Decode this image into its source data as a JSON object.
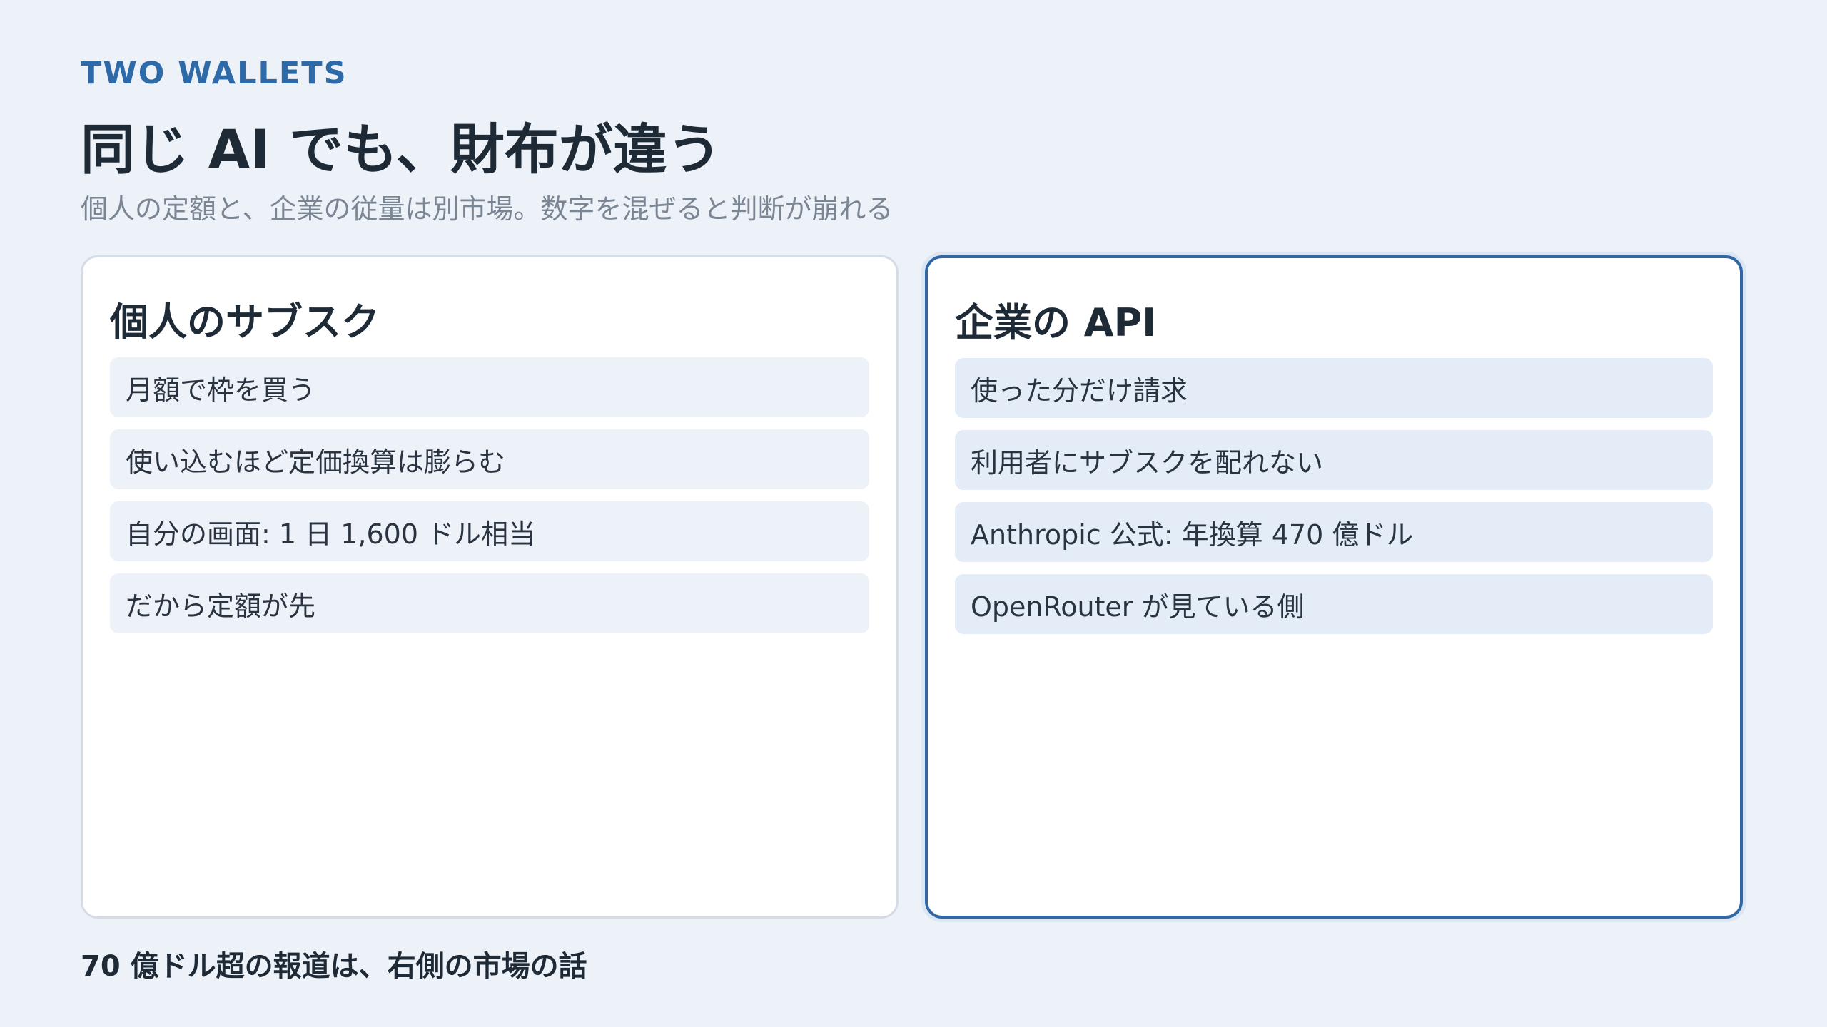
{
  "eyebrow": "TWO WALLETS",
  "title": "同じ AI でも、財布が違う",
  "subtitle": "個人の定額と、企業の従量は別市場。数字を混ぜると判断が崩れる",
  "cards": [
    {
      "title": "個人のサブスク",
      "items": [
        "月額で枠を買う",
        "使い込むほど定価換算は膨らむ",
        "自分の画面: 1 日 1,600 ドル相当",
        "だから定額が先"
      ]
    },
    {
      "title": "企業の API",
      "items": [
        "使った分だけ請求",
        "利用者にサブスクを配れない",
        "Anthropic 公式: 年換算 470 億ドル",
        "OpenRouter が見ている側"
      ]
    }
  ],
  "footer": "70 億ドル超の報道は、右側の市場の話",
  "colors": {
    "background": "#edf1f8",
    "accent": "#2f6aa8",
    "highlight_border": "#3267a6",
    "text": "#1f2a37",
    "muted": "#7b8694"
  }
}
